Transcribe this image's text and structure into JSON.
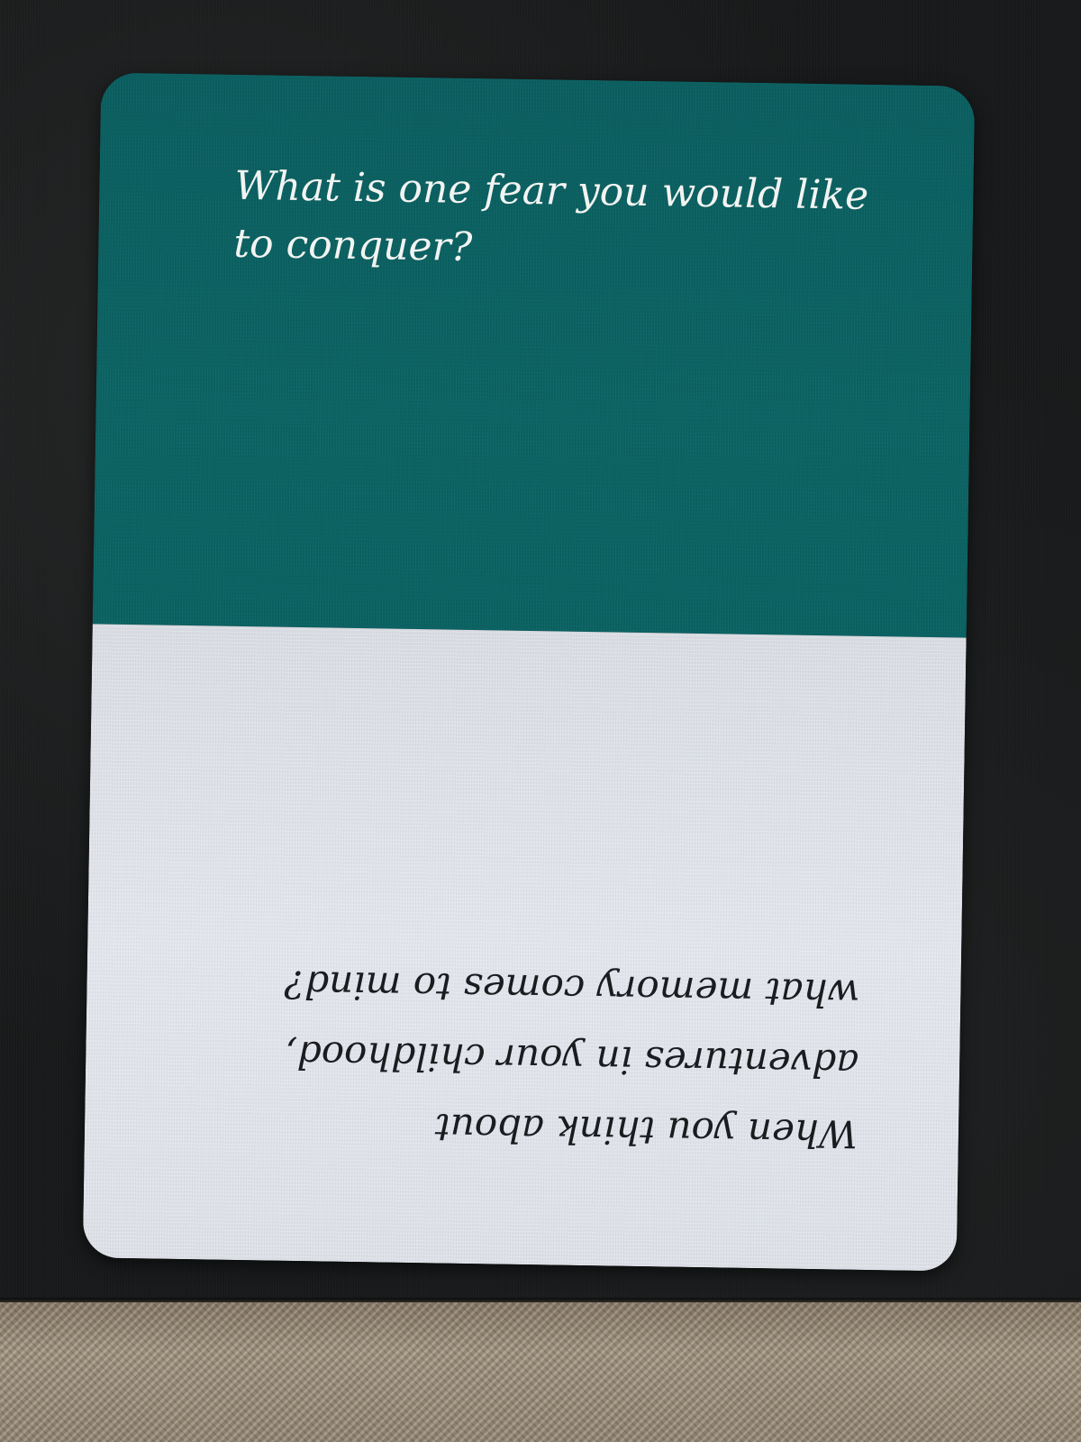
{
  "card": {
    "top_question": "What is one fear you would like to conquer?",
    "bottom_question": "When you think about adventures in your childhood, what memory comes to mind?"
  },
  "colors": {
    "card_top": "#0b6262",
    "card_bottom": "#e0e3ea",
    "top_text": "#f2f4f2",
    "bottom_text": "#1b1c1f",
    "background": "#17191a",
    "fabric_strip": "#a79a86"
  }
}
